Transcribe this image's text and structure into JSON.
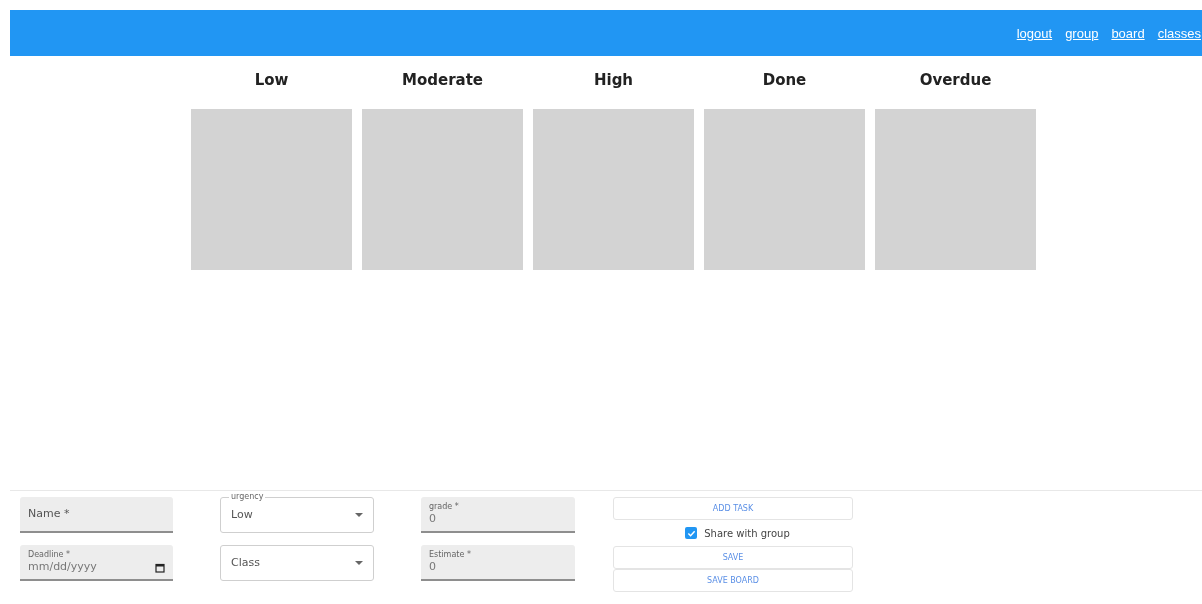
{
  "nav": {
    "links": [
      "logout",
      "group",
      "board",
      "classes"
    ]
  },
  "board": {
    "columns": [
      {
        "title": "Low"
      },
      {
        "title": "Moderate"
      },
      {
        "title": "High"
      },
      {
        "title": "Done"
      },
      {
        "title": "Overdue"
      }
    ]
  },
  "form": {
    "fields": [
      {
        "kind": "filled",
        "label": "Name *"
      },
      {
        "kind": "date",
        "label": "Deadline *",
        "value": "mm/dd/yyyy"
      },
      {
        "kind": "select",
        "label": "urgency",
        "value": "Low"
      },
      {
        "kind": "select",
        "placeholder": "Class"
      },
      {
        "kind": "filled",
        "label": "grade *",
        "value": "0"
      },
      {
        "kind": "filled",
        "label": "Estimate *",
        "value": "0"
      }
    ],
    "add_button": "ADD TASK",
    "share": {
      "label": "Share with group",
      "checked": true
    },
    "save_button": "SAVE",
    "save_board_button": "SAVE BOARD"
  }
}
